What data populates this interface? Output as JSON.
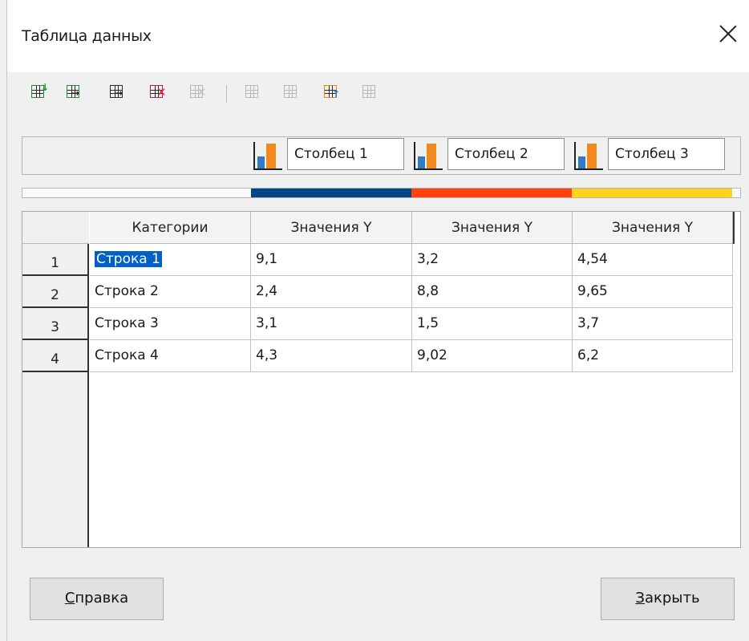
{
  "window": {
    "title": "Таблица данных"
  },
  "toolbar": {
    "icons": [
      "insert-row-icon",
      "insert-series-icon",
      "insert-text-column-icon",
      "delete-row-icon",
      "delete-series-icon",
      "move-row-down-icon",
      "move-row-up-icon",
      "move-series-right-icon",
      "move-series-left-icon"
    ]
  },
  "series": [
    {
      "name": "Столбец 1",
      "color": "#004586"
    },
    {
      "name": "Столбец 2",
      "color": "#ff420e"
    },
    {
      "name": "Столбец 3",
      "color": "#ffd320"
    }
  ],
  "table": {
    "headers": [
      "Категории",
      "Значения Y",
      "Значения Y",
      "Значения Y"
    ],
    "rows": [
      {
        "num": "1",
        "category": "Строка 1",
        "values": [
          "9,1",
          "3,2",
          "4,54"
        ]
      },
      {
        "num": "2",
        "category": "Строка 2",
        "values": [
          "2,4",
          "8,8",
          "9,65"
        ]
      },
      {
        "num": "3",
        "category": "Строка 3",
        "values": [
          "3,1",
          "1,5",
          "3,7"
        ]
      },
      {
        "num": "4",
        "category": "Строка 4",
        "values": [
          "4,3",
          "9,02",
          "6,2"
        ]
      }
    ],
    "selected_cell": "Строка 1"
  },
  "buttons": {
    "help_label_first": "С",
    "help_label_rest": "правка",
    "close_label_first": "З",
    "close_label_rest": "акрыть"
  }
}
